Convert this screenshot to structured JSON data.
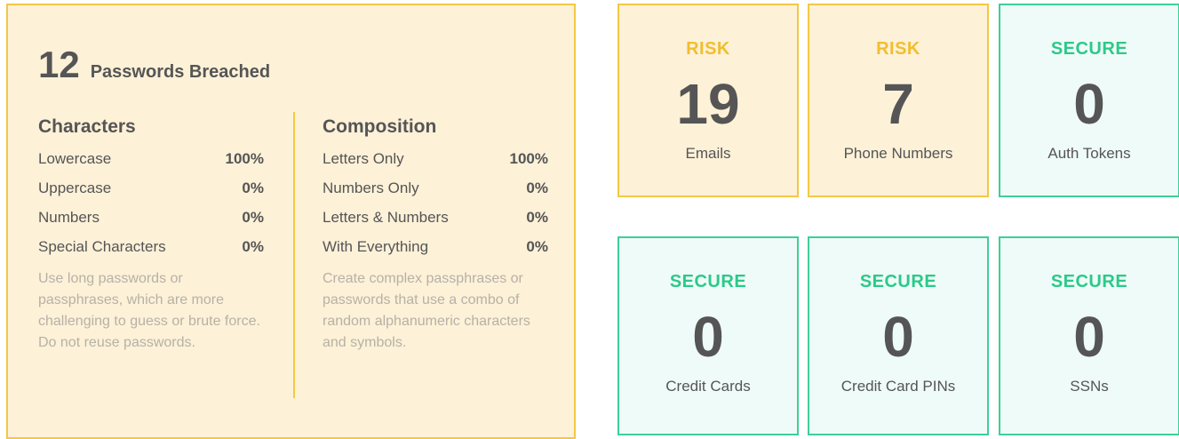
{
  "passwords": {
    "count": "12",
    "label": "Passwords Breached",
    "characters": {
      "title": "Characters",
      "rows": [
        {
          "label": "Lowercase",
          "value": "100%"
        },
        {
          "label": "Uppercase",
          "value": "0%"
        },
        {
          "label": "Numbers",
          "value": "0%"
        },
        {
          "label": "Special Characters",
          "value": "0%"
        }
      ],
      "tip": "Use long passwords or passphrases, which are more challenging to guess or brute force. Do not reuse passwords."
    },
    "composition": {
      "title": "Composition",
      "rows": [
        {
          "label": "Letters Only",
          "value": "100%"
        },
        {
          "label": "Numbers Only",
          "value": "0%"
        },
        {
          "label": "Letters & Numbers",
          "value": "0%"
        },
        {
          "label": "With Everything",
          "value": "0%"
        }
      ],
      "tip": "Create complex passphrases or passwords that use a combo of random alphanumeric characters and symbols."
    }
  },
  "cards": [
    {
      "status": "RISK",
      "count": "19",
      "label": "Emails"
    },
    {
      "status": "RISK",
      "count": "7",
      "label": "Phone Numbers"
    },
    {
      "status": "SECURE",
      "count": "0",
      "label": "Auth Tokens"
    },
    {
      "status": "SECURE",
      "count": "0",
      "label": "Credit Cards"
    },
    {
      "status": "SECURE",
      "count": "0",
      "label": "Credit Card PINs"
    },
    {
      "status": "SECURE",
      "count": "0",
      "label": "SSNs"
    }
  ],
  "colors": {
    "risk_accent": "#f2be2e",
    "risk_bg": "#fdf1d8",
    "secure_accent": "#2cc98a",
    "secure_bg": "#effbf8",
    "text": "#555555"
  }
}
